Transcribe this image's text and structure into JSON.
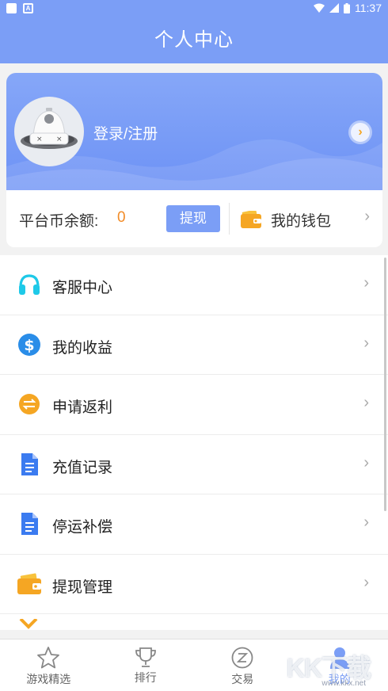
{
  "statusbar": {
    "time": "11:37",
    "badge": "A"
  },
  "header": {
    "title": "个人中心"
  },
  "profile": {
    "login_label": "登录/注册"
  },
  "balance": {
    "label": "平台币余额:",
    "value": "0",
    "withdraw_label": "提现",
    "wallet_label": "我的钱包"
  },
  "menu": [
    {
      "label": "客服中心",
      "icon": "headphones-icon",
      "color": "#1ec9e8"
    },
    {
      "label": "我的收益",
      "icon": "dollar-icon",
      "color": "#2a8de8"
    },
    {
      "label": "申请返利",
      "icon": "exchange-icon",
      "color": "#f5a623"
    },
    {
      "label": "充值记录",
      "icon": "document-icon",
      "color": "#3b7bf0"
    },
    {
      "label": "停运补偿",
      "icon": "document-icon",
      "color": "#3b7bf0"
    },
    {
      "label": "提现管理",
      "icon": "wallet-icon",
      "color": "#f5a623"
    }
  ],
  "tabs": [
    {
      "label": "游戏精选",
      "icon": "star-icon"
    },
    {
      "label": "排行",
      "icon": "trophy-icon"
    },
    {
      "label": "交易",
      "icon": "trade-icon"
    },
    {
      "label": "我的",
      "icon": "user-icon",
      "active": true
    }
  ],
  "watermark": {
    "text": "KK下载",
    "sub": "www.kkx.net"
  },
  "colors": {
    "primary": "#7b9ef6",
    "accent": "#f28c28"
  }
}
